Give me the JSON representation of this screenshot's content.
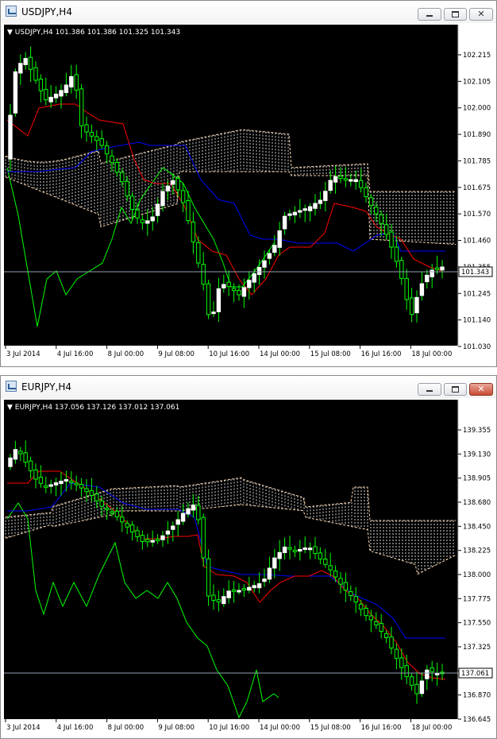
{
  "windows": [
    {
      "title": "USDJPY,H4",
      "header_label": "USDJPY,H4  101.386 101.386 101.325 101.343",
      "price_current": "101.343",
      "y_ticks": [
        "102.215",
        "102.105",
        "102.000",
        "101.890",
        "101.785",
        "101.675",
        "101.570",
        "101.460",
        "101.355",
        "101.245",
        "101.140",
        "101.030"
      ],
      "x_ticks": [
        "3 Jul 2014",
        "4 Jul 16:00",
        "8 Jul 00:00",
        "9 Jul 08:00",
        "10 Jul 16:00",
        "14 Jul 00:00",
        "15 Jul 08:00",
        "16 Jul 16:00",
        "18 Jul 00:00"
      ],
      "close_active": false
    },
    {
      "title": "EURJPY,H4",
      "header_label": "EURJPY,H4  137.056 137.126 137.012 137.061",
      "price_current": "137.061",
      "y_ticks": [
        "139.355",
        "139.130",
        "138.905",
        "138.680",
        "138.450",
        "138.225",
        "138.000",
        "137.775",
        "137.550",
        "137.325",
        "137.100",
        "136.870",
        "136.645"
      ],
      "x_ticks": [
        "3 Jul 2014",
        "4 Jul 16:00",
        "8 Jul 00:00",
        "9 Jul 08:00",
        "10 Jul 16:00",
        "14 Jul 00:00",
        "15 Jul 08:00",
        "16 Jul 16:00",
        "18 Jul 00:00"
      ],
      "close_active": true
    }
  ],
  "colors": {
    "background": "#000000",
    "grid_text": "#ffffff",
    "candle_up": "#ffffff",
    "candle_wick": "#00ff00",
    "tenkan": "#ff0000",
    "kijun": "#0000ff",
    "chikou": "#00ff00",
    "kumo": "#ffd8b0",
    "bid_line": "#8fa0b0"
  },
  "icons": {
    "app": "chart-window-icon",
    "minimize": "minimize-icon",
    "maximize": "maximize-icon",
    "close": "close-icon"
  }
}
